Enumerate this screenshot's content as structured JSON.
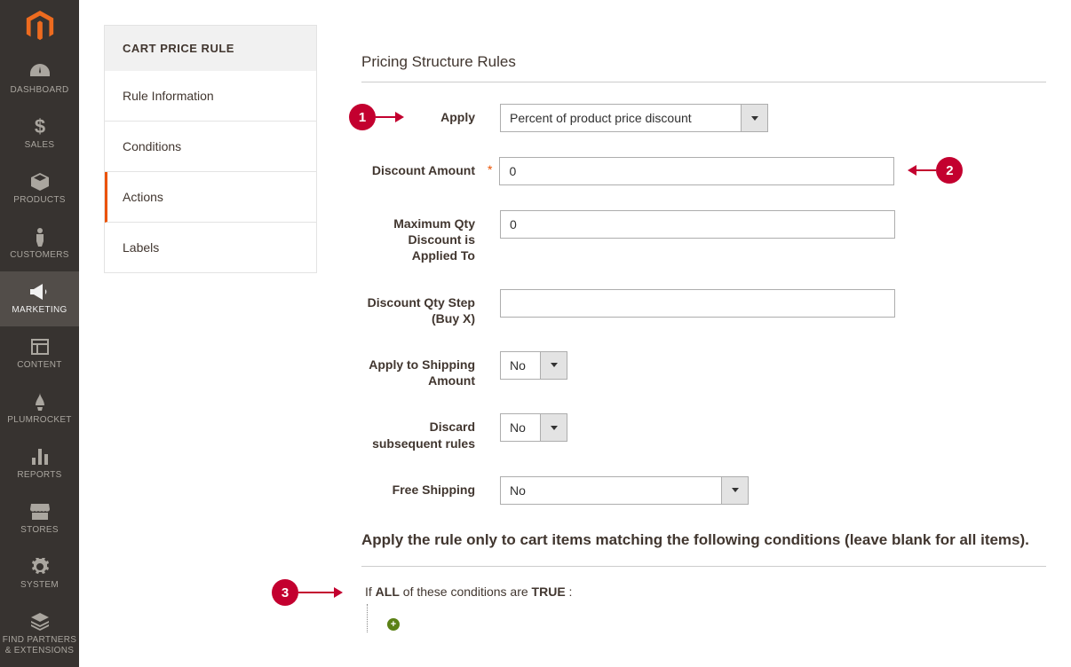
{
  "nav": {
    "items": [
      {
        "label": "DASHBOARD"
      },
      {
        "label": "SALES"
      },
      {
        "label": "PRODUCTS"
      },
      {
        "label": "CUSTOMERS"
      },
      {
        "label": "MARKETING"
      },
      {
        "label": "CONTENT"
      },
      {
        "label": "PLUMROCKET"
      },
      {
        "label": "REPORTS"
      },
      {
        "label": "STORES"
      },
      {
        "label": "SYSTEM"
      },
      {
        "label": "FIND PARTNERS & EXTENSIONS"
      }
    ]
  },
  "panel": {
    "header": "CART PRICE RULE",
    "items": [
      {
        "label": "Rule Information"
      },
      {
        "label": "Conditions"
      },
      {
        "label": "Actions"
      },
      {
        "label": "Labels"
      }
    ]
  },
  "form": {
    "section_title": "Pricing Structure Rules",
    "apply": {
      "label": "Apply",
      "value": "Percent of product price discount"
    },
    "discount_amount": {
      "label": "Discount Amount",
      "value": "0"
    },
    "max_qty": {
      "label": "Maximum Qty Discount is Applied To",
      "value": "0"
    },
    "qty_step": {
      "label": "Discount Qty Step (Buy X)",
      "value": ""
    },
    "apply_shipping": {
      "label": "Apply to Shipping Amount",
      "value": "No"
    },
    "discard": {
      "label": "Discard subsequent rules",
      "value": "No"
    },
    "free_shipping": {
      "label": "Free Shipping",
      "value": "No"
    },
    "subsection": "Apply the rule only to cart items matching the following conditions (leave blank for all items).",
    "condition": {
      "prefix": "If ",
      "all": "ALL",
      "mid": "  of these conditions are ",
      "true": "TRUE",
      "suffix": " :"
    }
  },
  "annotations": {
    "a1": "1",
    "a2": "2",
    "a3": "3"
  }
}
